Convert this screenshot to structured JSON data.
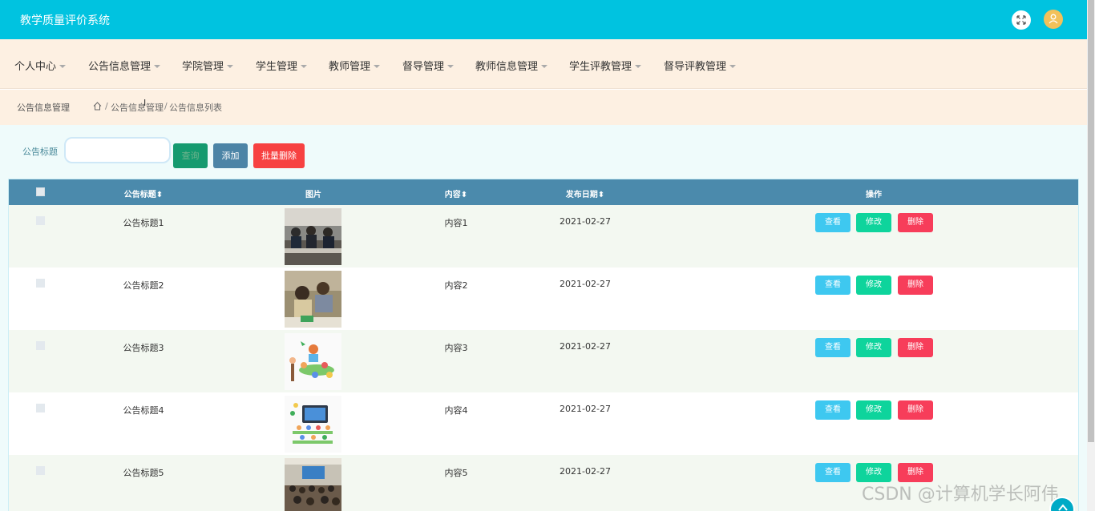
{
  "app": {
    "title": "教学质量评价系统"
  },
  "nav": {
    "items": [
      {
        "label": "个人中心"
      },
      {
        "label": "公告信息管理"
      },
      {
        "label": "学院管理"
      },
      {
        "label": "学生管理"
      },
      {
        "label": "教师管理"
      },
      {
        "label": "督导管理"
      },
      {
        "label": "教师信息管理"
      },
      {
        "label": "学生评教管理"
      },
      {
        "label": "督导评教管理"
      }
    ]
  },
  "breadcrumb": {
    "section": "公告信息管理",
    "items": [
      "公告信息管理",
      "公告信息列表"
    ],
    "separator": "/"
  },
  "search": {
    "label": "公告标题",
    "value": "",
    "query_button": "查询",
    "add_button": "添加",
    "batch_delete_button": "批量删除"
  },
  "table": {
    "headers": {
      "title": "公告标题",
      "picture": "图片",
      "content": "内容",
      "date": "发布日期",
      "actions": "操作"
    },
    "rows": [
      {
        "title": "公告标题1",
        "content": "内容1",
        "date": "2021-02-27",
        "image": "students-classroom-photo"
      },
      {
        "title": "公告标题2",
        "content": "内容2",
        "date": "2021-02-27",
        "image": "teacher-child-photo"
      },
      {
        "title": "公告标题3",
        "content": "内容3",
        "date": "2021-02-27",
        "image": "cartoon-class-illustration"
      },
      {
        "title": "公告标题4",
        "content": "内容4",
        "date": "2021-02-27",
        "image": "online-class-illustration"
      },
      {
        "title": "公告标题5",
        "content": "内容5",
        "date": "2021-02-27",
        "image": "lecture-hall-photo"
      }
    ],
    "actions": {
      "view": "查看",
      "edit": "修改",
      "delete": "删除"
    }
  },
  "watermark": "CSDN @计算机学长阿伟",
  "colors": {
    "header": "#00c3e0",
    "nav_bg": "#fdf0e2",
    "table_header": "#4b8aac",
    "view": "#3ec8f0",
    "edit": "#0ed49c",
    "delete": "#f73d5a"
  }
}
